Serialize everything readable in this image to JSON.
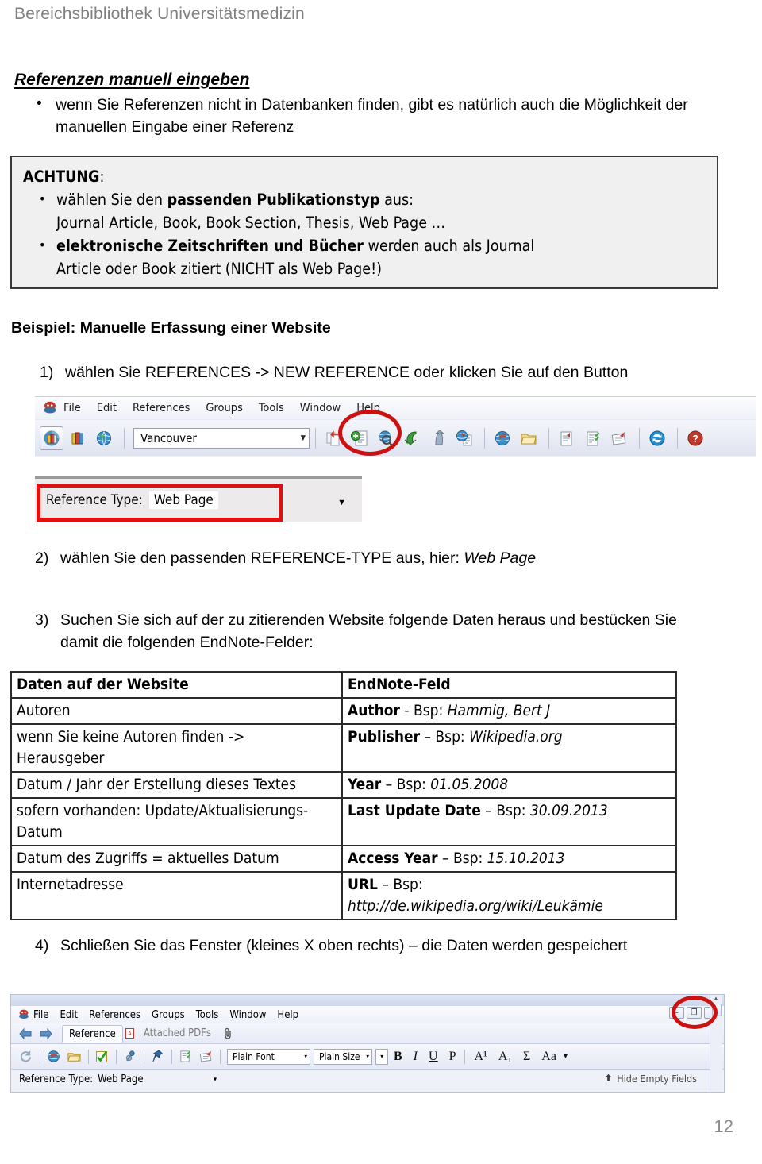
{
  "header": {
    "running_title": "Bereichsbibliothek Universitätsmedizin"
  },
  "section": {
    "title": "Referenzen manuell eingeben",
    "intro_bullets": [
      "wenn Sie Referenzen nicht in Datenbanken finden, gibt es natürlich auch die Möglichkeit der manuellen Eingabe einer Referenz"
    ]
  },
  "achtung": {
    "heading": "ACHTUNG",
    "heading_colon": ":",
    "bullet1_pre": "wählen Sie den ",
    "bullet1_bold": "passenden Publikationstyp",
    "bullet1_post": " aus:",
    "bullet1_line2": "Journal Article, Book, Book Section, Thesis, Web Page …",
    "bullet2_bold": "elektronische Zeitschriften und Bücher",
    "bullet2_post": " werden auch als Journal",
    "bullet2_line2": "Article oder Book zitiert (NICHT als Web Page!)"
  },
  "beispiel_heading": "Beispiel: Manuelle Erfassung einer Website",
  "steps": [
    {
      "num": "1)",
      "text": "wählen Sie REFERENCES -> NEW REFERENCE oder klicken Sie auf den Button"
    },
    {
      "num": "2)",
      "text": "wählen Sie den passenden REFERENCE-TYPE aus, hier: ",
      "italic_tail": "Web Page"
    },
    {
      "num": "3)",
      "text": "Suchen Sie sich auf der zu zitierenden Website folgende Daten heraus und bestücken Sie damit die folgenden EndNote-Felder:"
    },
    {
      "num": "4)",
      "text": "Schließen Sie das Fenster (kleines X oben rechts) – die Daten werden gespeichert"
    }
  ],
  "screenshot_toolbar": {
    "menu_items": [
      "File",
      "Edit",
      "References",
      "Groups",
      "Tools",
      "Window",
      "Help"
    ],
    "app_icon": "endnote-logo-icon",
    "style_combo_value": "Vancouver",
    "style_combo_arrow": "▼",
    "left_icons": [
      "library-icon",
      "groups-books-icon",
      "online-search-globe-icon"
    ],
    "toolbar_icons": [
      "copy-to-local-library-icon",
      "new-reference-icon",
      "online-search-magnifier-icon",
      "import-arrow-icon",
      "export-arrow-icon",
      "open-link-globe-icon",
      "online-globe-icon",
      "open-folder-icon",
      "insert-citation-icon",
      "format-bibliography-icon",
      "edit-citation-icon",
      "sync-icon",
      "help-icon"
    ],
    "highlight": "red-circle-around-new-reference"
  },
  "screenshot_reftype": {
    "label": "Reference Type:",
    "value": "Web Page",
    "arrow": "▼",
    "highlight": "red-rectangle"
  },
  "table": {
    "columns": [
      "Daten auf der Website",
      "EndNote-Feld"
    ],
    "rows": [
      {
        "left": "Autoren",
        "right_bold": "Author",
        "right_sep": " - Bsp: ",
        "right_italic": "Hammig, Bert J"
      },
      {
        "left": "wenn Sie keine Autoren finden -> Herausgeber",
        "right_bold": "Publisher",
        "right_sep": " – Bsp: ",
        "right_italic": "Wikipedia.org"
      },
      {
        "left": "Datum / Jahr der Erstellung dieses Textes",
        "right_bold": "Year",
        "right_sep": " – Bsp: ",
        "right_italic": "01.05.2008"
      },
      {
        "left": "sofern vorhanden: Update/Aktualisierungs-Datum",
        "right_bold": "Last Update Date",
        "right_sep": " – Bsp: ",
        "right_italic": "30.09.2013"
      },
      {
        "left": "Datum des Zugriffs = aktuelles Datum",
        "right_bold": "Access Year",
        "right_sep": " – Bsp: ",
        "right_italic": "15.10.2013"
      },
      {
        "left": "Internetadresse",
        "right_bold": "URL",
        "right_sep": " – Bsp: ",
        "right_italic": "http://de.wikipedia.org/wiki/Leukämie"
      }
    ]
  },
  "screenshot_window": {
    "menu_items": [
      "File",
      "Edit",
      "References",
      "Groups",
      "Tools",
      "Window",
      "Help"
    ],
    "window_buttons": [
      "–",
      "❐",
      "✕"
    ],
    "tabs": [
      "Reference",
      "Attached PDFs"
    ],
    "attachment_icon": "paperclip-icon",
    "toolbar_icons": [
      "refresh-icon",
      "online-globe-icon",
      "open-folder-icon",
      "check-green-icon",
      "link-pin-icon",
      "pin-icon",
      "insert-citation-icon",
      "format-bibliography-icon"
    ],
    "font_combo": "Plain Font",
    "size_combo": "Plain Size",
    "format_buttons": [
      "B",
      "I",
      "U",
      "P",
      "A¹",
      "A₁",
      "Σ",
      "Aa"
    ],
    "format_arrow": "▾",
    "reference_type_label": "Reference Type:",
    "reference_type_value": "Web Page",
    "hide_empty_fields": "Hide Empty Fields",
    "hide_empty_icon": "collapse-arrow-icon",
    "highlight": "red-circle-around-close-button"
  },
  "page_number": "12"
}
